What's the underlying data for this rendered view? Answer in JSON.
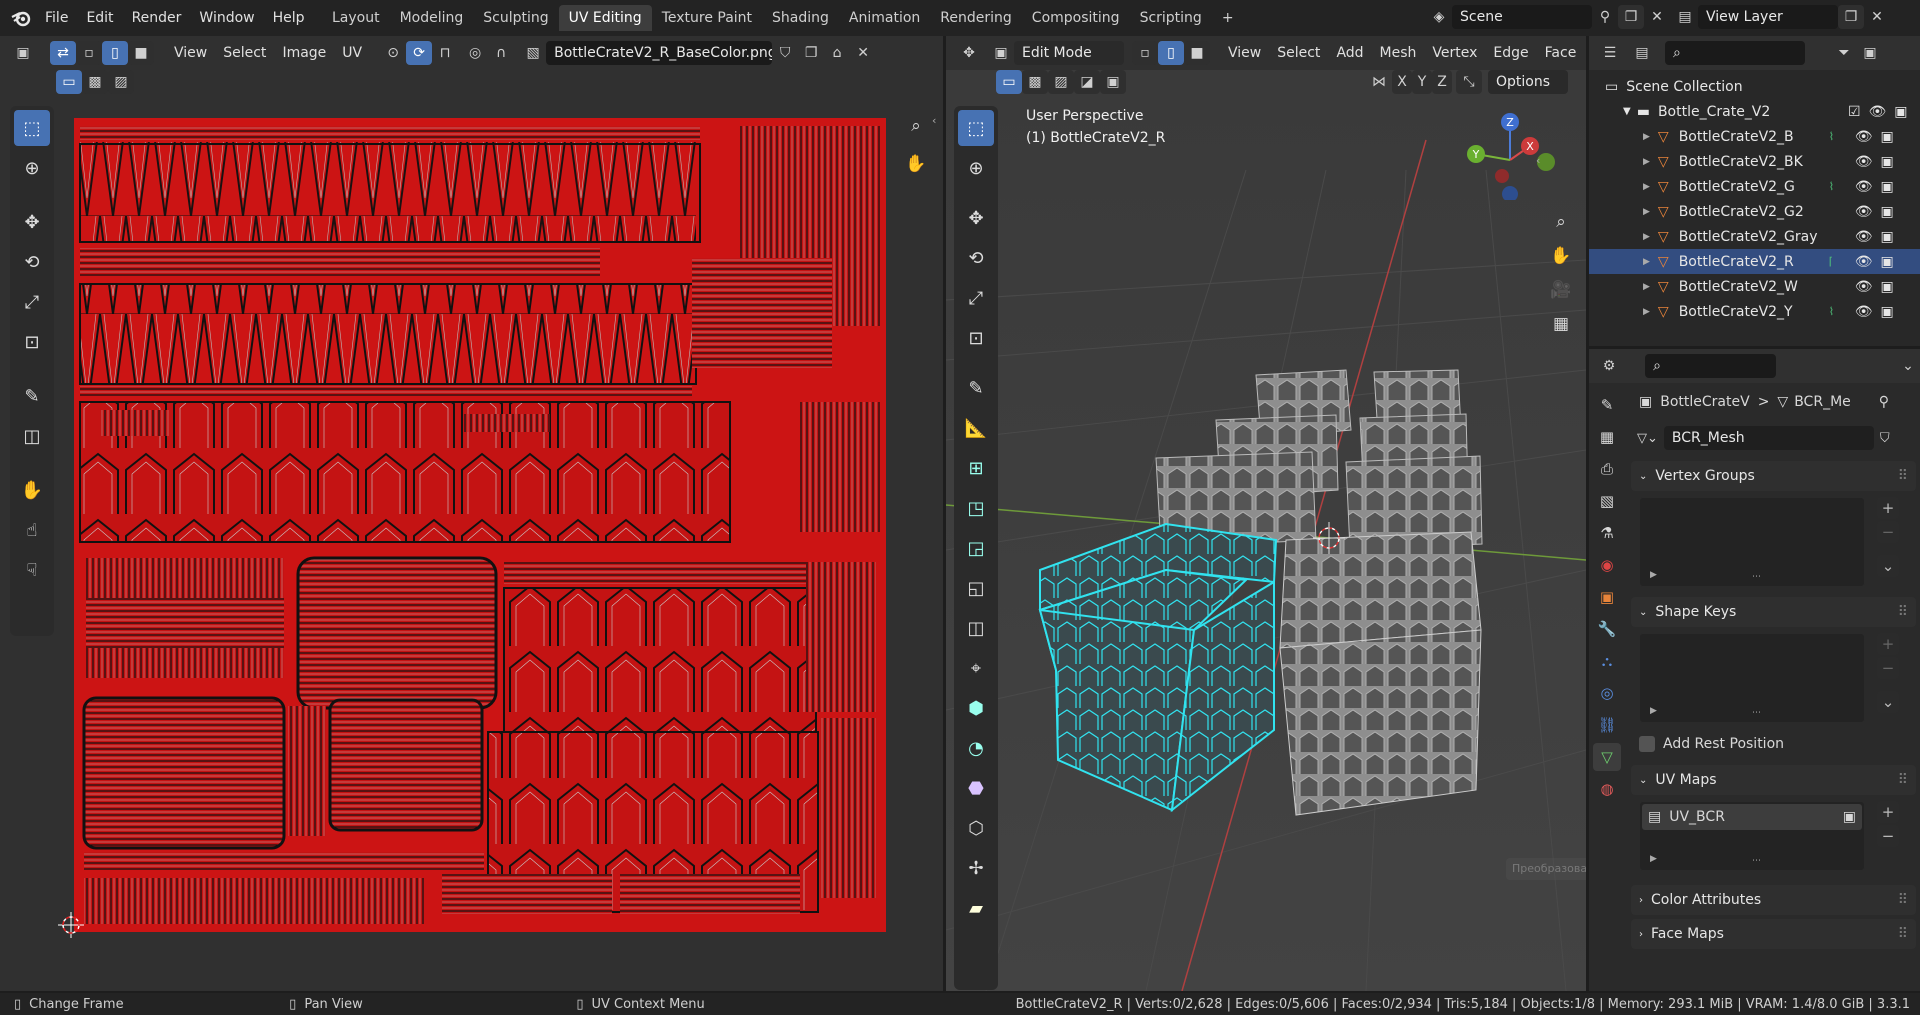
{
  "topbar": {
    "menus": [
      "File",
      "Edit",
      "Render",
      "Window",
      "Help"
    ],
    "workspaces": [
      "Layout",
      "Modeling",
      "Sculpting",
      "UV Editing",
      "Texture Paint",
      "Shading",
      "Animation",
      "Rendering",
      "Compositing",
      "Scripting"
    ],
    "active_workspace": "UV Editing",
    "add_tab": "+",
    "scene": "Scene",
    "view_layer": "View Layer"
  },
  "uv_editor": {
    "menus": [
      "View",
      "Select",
      "Image",
      "UV"
    ],
    "image_name": "BottleCrateV2_R_BaseColor.png",
    "texture_color": "#cc1414"
  },
  "viewport": {
    "mode": "Edit Mode",
    "menus": [
      "View",
      "Select",
      "Add",
      "Mesh",
      "Vertex",
      "Edge",
      "Face"
    ],
    "axes": [
      "X",
      "Y",
      "Z"
    ],
    "options": "Options",
    "perspective": "User Perspective",
    "object_label": "(1) BottleCrateV2_R",
    "gizmo": {
      "z": "Z",
      "y": "Y",
      "x": "X"
    },
    "tooltip": "Преобразовать"
  },
  "outliner": {
    "root": "Scene Collection",
    "collection": "Bottle_Crate_V2",
    "items": [
      "BottleCrateV2_B",
      "BottleCrateV2_BK",
      "BottleCrateV2_G",
      "BottleCrateV2_G2",
      "BottleCrateV2_Gray",
      "BottleCrateV2_R",
      "BottleCrateV2_W",
      "BottleCrateV2_Y"
    ],
    "selected": "BottleCrateV2_R"
  },
  "properties": {
    "breadcrumb_object": "BottleCrateV",
    "breadcrumb_sep": ">",
    "breadcrumb_mesh": "BCR_Me",
    "mesh_name": "BCR_Mesh",
    "panels": {
      "vertex_groups": "Vertex Groups",
      "shape_keys": "Shape Keys",
      "add_rest_position": "Add Rest Position",
      "uv_maps": "UV Maps",
      "uv_map_item": "UV_BCR",
      "color_attributes": "Color Attributes",
      "face_maps": "Face Maps"
    }
  },
  "statusbar": {
    "left1": "Change Frame",
    "left2": "Pan View",
    "left3": "UV Context Menu",
    "stats": "BottleCrateV2_R | Verts:0/2,628 | Edges:0/5,606 | Faces:0/2,934 | Tris:5,184 | Objects:1/8 | Memory: 293.1 MiB | VRAM: 1.4/8.0 GiB | 3.3.1"
  }
}
